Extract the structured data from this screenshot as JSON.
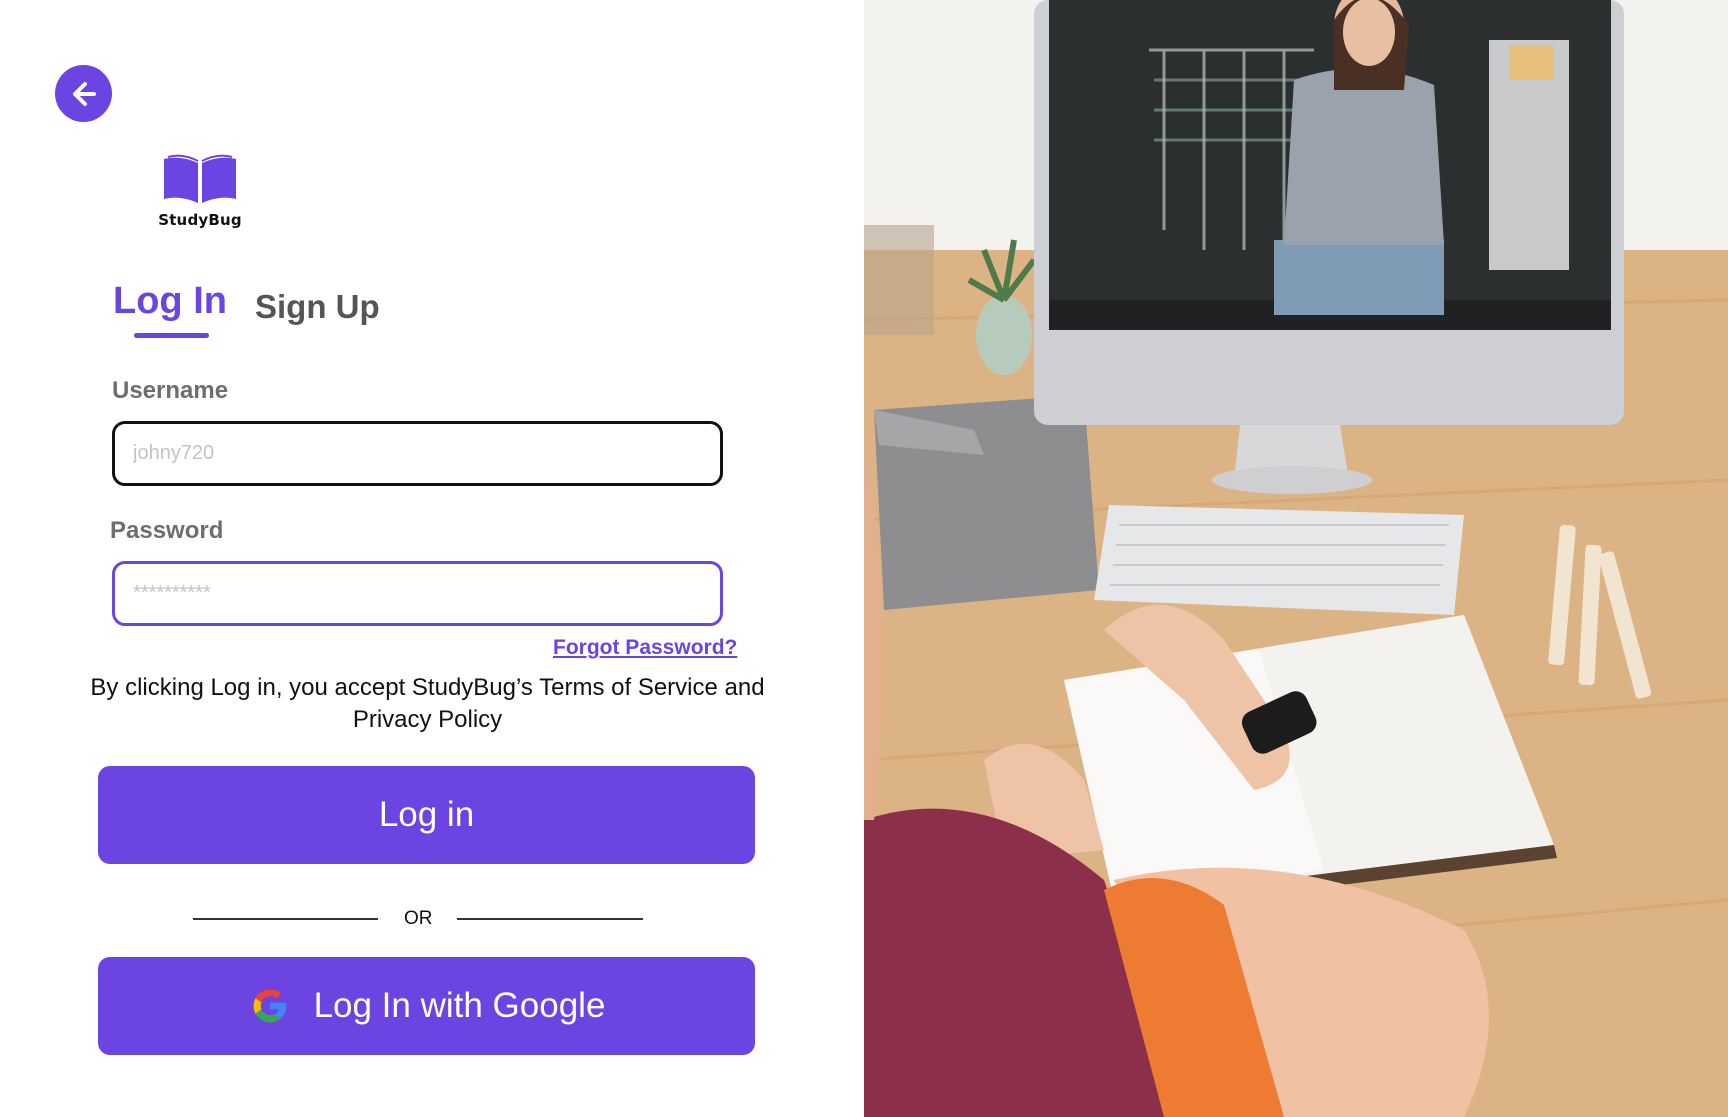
{
  "app": {
    "name": "StudyBug"
  },
  "tabs": {
    "login": "Log In",
    "signup": "Sign Up"
  },
  "form": {
    "username_label": "Username",
    "username_placeholder": "johny720",
    "username_value": "",
    "password_label": "Password",
    "password_placeholder": "**********",
    "password_value": "",
    "forgot_link": "Forgot Password?",
    "terms": "By clicking Log in, you accept StudyBug’s Terms of Service and Privacy Policy",
    "login_button": "Log in",
    "divider": "OR",
    "google_button": "Log In with Google"
  },
  "icons": {
    "back": "arrow-left-icon",
    "logo": "open-book-icon",
    "google": "google-g-icon"
  },
  "colors": {
    "accent": "#6c44e2",
    "label_gray": "#6e6e6e",
    "input_border": "#111111"
  }
}
